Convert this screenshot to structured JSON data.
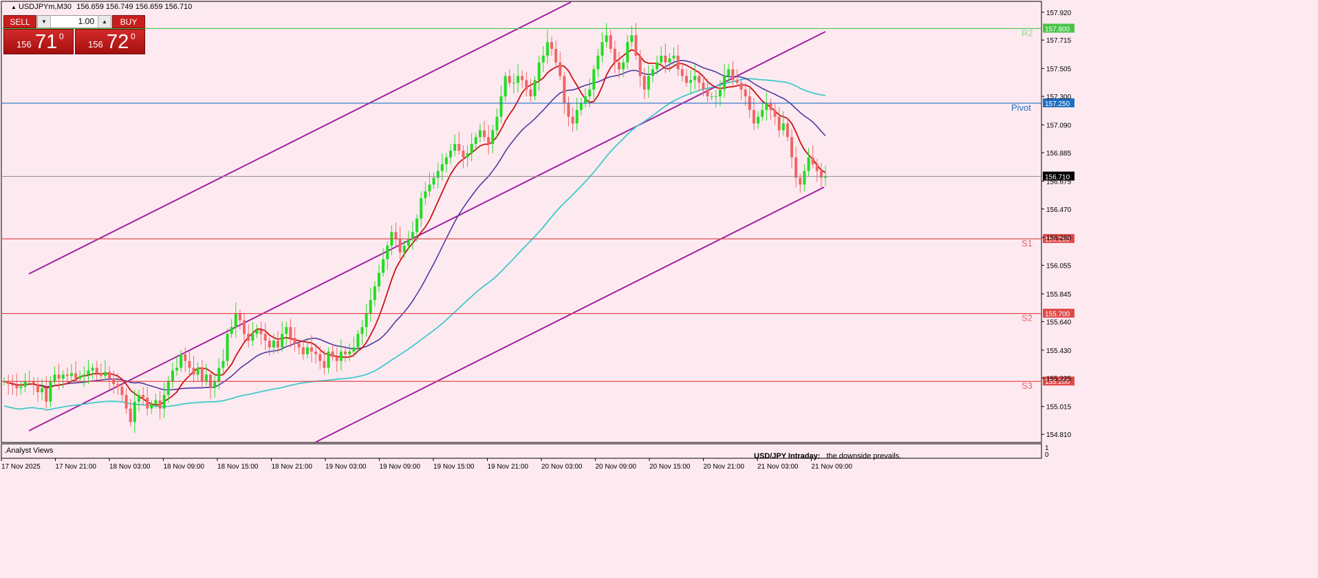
{
  "header": {
    "symbol": "USDJPYm,M30",
    "ohlc": "156.659 156.749 156.659 156.710"
  },
  "toolbox": {
    "sell_label": "SELL",
    "buy_label": "BUY",
    "lot_value": "1.00",
    "bid_prefix": "156",
    "bid_big": "71",
    "bid_sup": "0",
    "ask_prefix": "156",
    "ask_big": "72",
    "ask_sup": "0"
  },
  "price_axis": {
    "labels": [
      "157.920",
      "157.715",
      "157.505",
      "157.300",
      "157.090",
      "156.885",
      "156.675",
      "156.470",
      "156.260",
      "156.055",
      "155.845",
      "155.640",
      "155.430",
      "155.225",
      "155.015",
      "154.810"
    ],
    "current_price": "156.710",
    "current_color": "#000000"
  },
  "levels": [
    {
      "name": "R2",
      "label": "R2",
      "price": 157.8,
      "tag": "157.800",
      "color": "#49c449",
      "label_color": "#8fd88f"
    },
    {
      "name": "Pivot",
      "label": "Pivot",
      "price": 157.25,
      "tag": "157.250",
      "color": "#1f6fc0",
      "label_color": "#1f6fc0"
    },
    {
      "name": "S1",
      "label": "S1",
      "price": 156.25,
      "tag": "156.250",
      "color": "#e04a4a",
      "label_color": "#e06868"
    },
    {
      "name": "S2",
      "label": "S2",
      "price": 155.7,
      "tag": "155.700",
      "color": "#e04a4a",
      "label_color": "#e06868"
    },
    {
      "name": "S3",
      "label": "S3",
      "price": 155.2,
      "tag": "155.200",
      "color": "#e04a4a",
      "label_color": "#e06868"
    }
  ],
  "time_axis": [
    "17 Nov 2025",
    "17 Nov 21:00",
    "18 Nov 03:00",
    "18 Nov 09:00",
    "18 Nov 15:00",
    "18 Nov 21:00",
    "19 Nov 03:00",
    "19 Nov 09:00",
    "19 Nov 15:00",
    "19 Nov 21:00",
    "20 Nov 03:00",
    "20 Nov 09:00",
    "20 Nov 15:00",
    "20 Nov 21:00",
    "21 Nov 03:00",
    "21 Nov 09:00"
  ],
  "subwindow": {
    "title": ".Analyst Views",
    "scale_top": "1",
    "scale_bottom": "0"
  },
  "footer": {
    "title": "USD/JPY Intraday:",
    "text": "the downside prevails."
  },
  "colors": {
    "background": "#fdeaf1",
    "bull_candle": "#22dd22",
    "bear_candle": "#ef6666",
    "channel": "#a020a0",
    "ma_fast": "#cc1010",
    "ma_mid": "#4a3aa0",
    "ma_slow": "#40c8c8"
  },
  "chart_data": {
    "type": "candlestick",
    "symbol": "USDJPYm",
    "timeframe": "M30",
    "ylim": [
      154.75,
      158.0
    ],
    "close_series": [
      155.2,
      155.18,
      155.17,
      155.15,
      155.16,
      155.2,
      155.2,
      155.18,
      155.12,
      155.15,
      155.05,
      155.2,
      155.25,
      155.22,
      155.25,
      155.24,
      155.26,
      155.22,
      155.24,
      155.25,
      155.28,
      155.3,
      155.26,
      155.24,
      155.27,
      155.22,
      155.18,
      155.16,
      155.1,
      155.0,
      154.9,
      155.05,
      155.1,
      155.08,
      155.0,
      155.03,
      155.06,
      155.0,
      155.1,
      155.2,
      155.28,
      155.3,
      155.4,
      155.35,
      155.3,
      155.25,
      155.3,
      155.2,
      155.25,
      155.15,
      155.2,
      155.3,
      155.35,
      155.55,
      155.6,
      155.7,
      155.65,
      155.55,
      155.5,
      155.55,
      155.58,
      155.55,
      155.5,
      155.45,
      155.5,
      155.45,
      155.55,
      155.6,
      155.52,
      155.48,
      155.45,
      155.4,
      155.45,
      155.42,
      155.4,
      155.35,
      155.3,
      155.42,
      155.38,
      155.35,
      155.42,
      155.4,
      155.42,
      155.45,
      155.55,
      155.6,
      155.7,
      155.8,
      155.9,
      156.0,
      156.1,
      156.2,
      156.3,
      156.25,
      156.15,
      156.2,
      156.25,
      156.3,
      156.4,
      156.55,
      156.6,
      156.65,
      156.7,
      156.75,
      156.8,
      156.85,
      156.9,
      156.95,
      156.9,
      156.85,
      156.88,
      156.95,
      157.0,
      157.05,
      157.0,
      156.95,
      157.05,
      157.15,
      157.3,
      157.45,
      157.4,
      157.4,
      157.45,
      157.42,
      157.35,
      157.3,
      157.42,
      157.55,
      157.6,
      157.7,
      157.65,
      157.55,
      157.45,
      157.25,
      157.15,
      157.1,
      157.2,
      157.25,
      157.3,
      157.35,
      157.5,
      157.6,
      157.7,
      157.75,
      157.65,
      157.55,
      157.5,
      157.55,
      157.7,
      157.75,
      157.6,
      157.45,
      157.35,
      157.45,
      157.5,
      157.55,
      157.6,
      157.55,
      157.58,
      157.6,
      157.5,
      157.45,
      157.4,
      157.42,
      157.45,
      157.4,
      157.35,
      157.3,
      157.3,
      157.3,
      157.35,
      157.45,
      157.5,
      157.42,
      157.4,
      157.35,
      157.3,
      157.2,
      157.1,
      157.15,
      157.2,
      157.25,
      157.2,
      157.15,
      157.05,
      157.1,
      157.0,
      156.85,
      156.7,
      156.65,
      156.75,
      156.85,
      156.8,
      156.75,
      156.7,
      156.71
    ],
    "series": [
      {
        "name": "MA fast",
        "color": "#cc1010"
      },
      {
        "name": "MA mid",
        "color": "#4a3aa0"
      },
      {
        "name": "MA slow",
        "color": "#40c8c8"
      }
    ]
  }
}
